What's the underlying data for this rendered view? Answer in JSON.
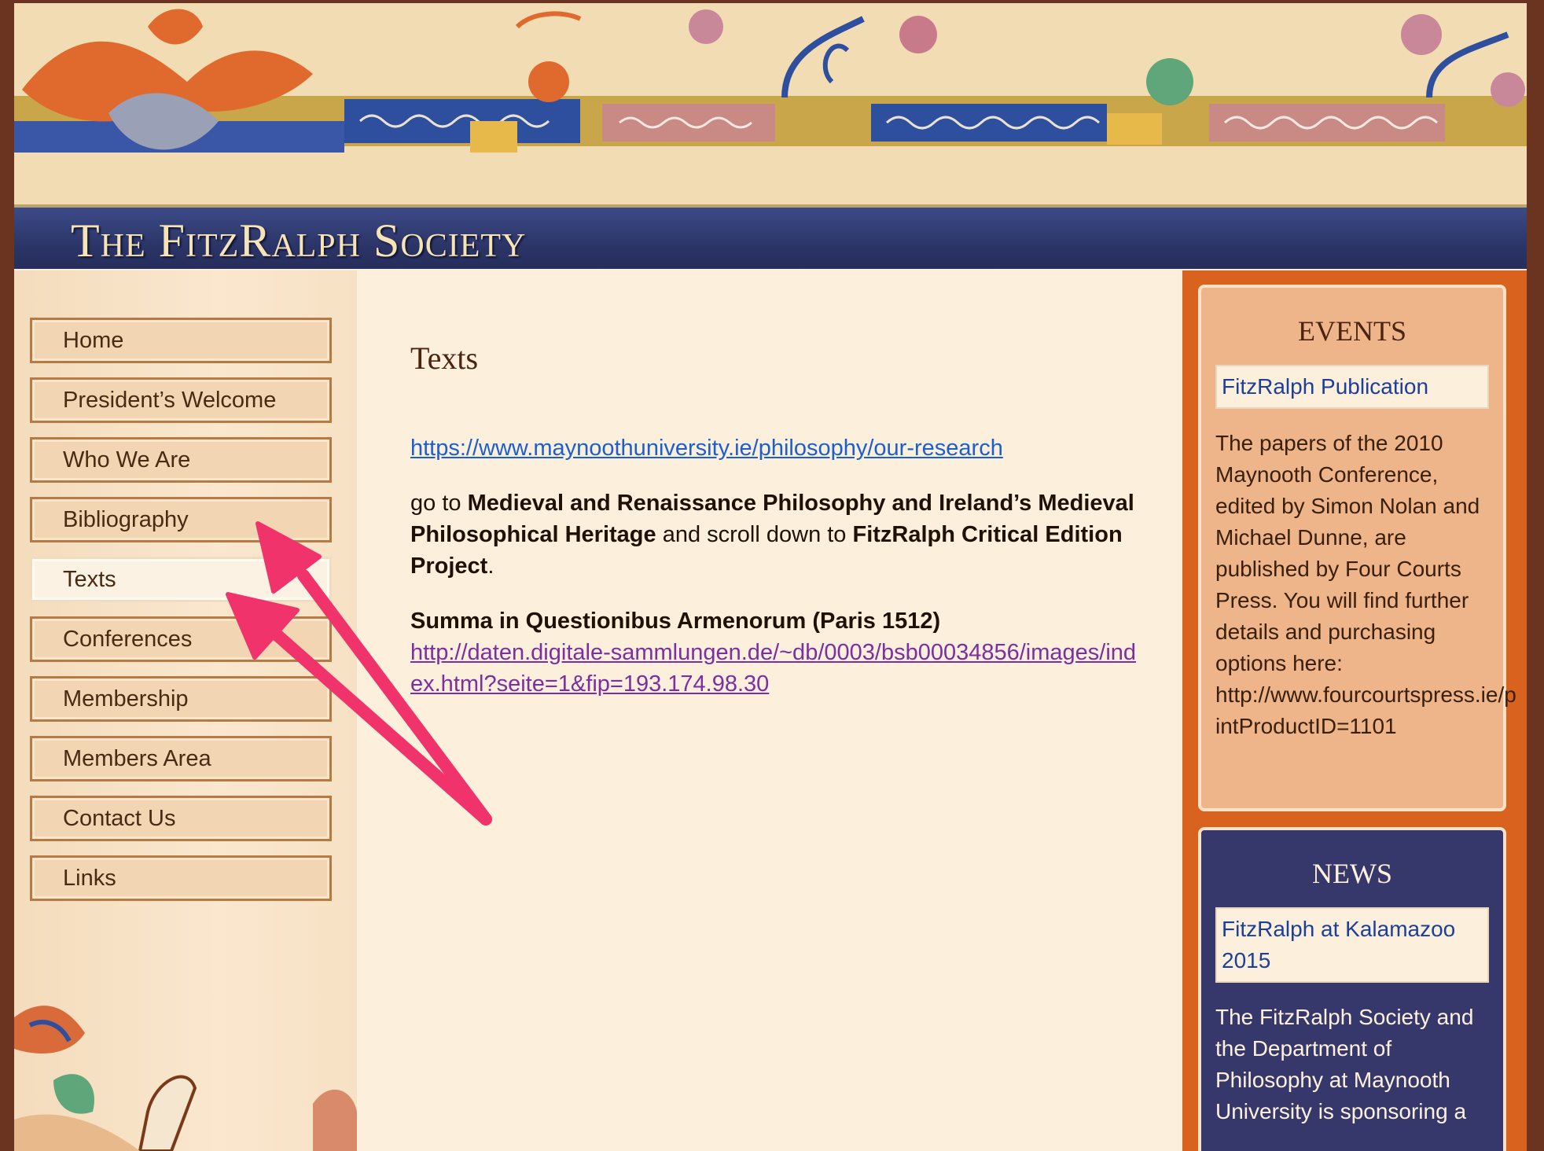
{
  "site": {
    "title": "The FitzRalph Society"
  },
  "nav": {
    "items": [
      {
        "label": "Home"
      },
      {
        "label": "President’s Welcome"
      },
      {
        "label": "Who We Are"
      },
      {
        "label": "Bibliography"
      },
      {
        "label": "Texts",
        "active": true
      },
      {
        "label": "Conferences"
      },
      {
        "label": "Membership"
      },
      {
        "label": "Members Area"
      },
      {
        "label": "Contact Us"
      },
      {
        "label": "Links"
      }
    ]
  },
  "main": {
    "heading": "Texts",
    "link1": "https://www.maynoothuniversity.ie/philosophy/our-research",
    "para": {
      "go_to": "go to ",
      "bold1": "Medieval and Renaissance Philosophy and Ireland’s Medieval Philosophical Heritage",
      "scroll": " and scroll down to ",
      "bold2": "FitzRalph Critical Edition Project",
      "end": "."
    },
    "summa_title": "Summa in Questionibus Armenorum (Paris 1512)",
    "link2": "http://daten.digitale-sammlungen.de/~db/0003/bsb00034856/images/index.html?seite=1&fip=193.174.98.30"
  },
  "events": {
    "title": "EVENTS",
    "link": "FitzRalph Publication",
    "text": "The papers of the 2010 Maynooth Conference, edited by Simon Nolan and Michael Dunne, are published by Four Courts Press. You will find further details and purchasing options here:",
    "url": "http://www.fourcourtspress.ie/p",
    "url_cont": "intProductID=1101"
  },
  "news": {
    "title": "NEWS",
    "link": "FitzRalph at Kalamazoo 2015",
    "text": "The FitzRalph Society and the Department of Philosophy at Maynooth University is sponsoring a"
  },
  "colors": {
    "title_bar": "#2b3466",
    "right_column": "#d9621f",
    "events_box": "#eeb58a",
    "news_box": "#36386c",
    "annotation_arrow": "#f0336b"
  }
}
